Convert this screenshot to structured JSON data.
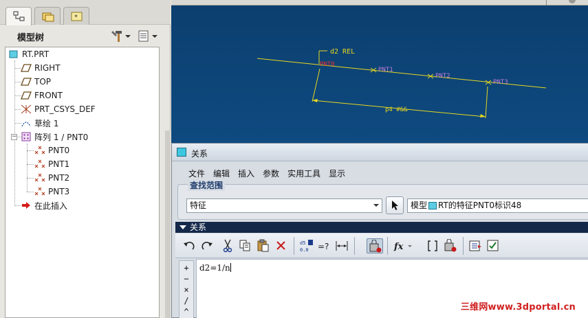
{
  "left_panel": {
    "tree_title": "模型树",
    "tabs": [
      "model-tree-tab",
      "folder-browser-tab",
      "favorites-tab"
    ],
    "tree_items": [
      {
        "label": "RT.PRT",
        "icon": "part-icon"
      },
      {
        "label": "RIGHT",
        "icon": "datum-plane-icon"
      },
      {
        "label": "TOP",
        "icon": "datum-plane-icon"
      },
      {
        "label": "FRONT",
        "icon": "datum-plane-icon"
      },
      {
        "label": "PRT_CSYS_DEF",
        "icon": "coordinate-system-icon"
      },
      {
        "label": "草绘 1",
        "icon": "sketch-icon"
      },
      {
        "label": "阵列 1 / PNT0",
        "icon": "pattern-icon"
      },
      {
        "label": "PNT0",
        "icon": "datum-point-icon"
      },
      {
        "label": "PNT1",
        "icon": "datum-point-icon"
      },
      {
        "label": "PNT2",
        "icon": "datum-point-icon"
      },
      {
        "label": "PNT3",
        "icon": "datum-point-icon"
      },
      {
        "label": "在此插入",
        "icon": "insert-here-arrow-icon"
      }
    ]
  },
  "viewport": {
    "dimension_label": "d2 REL",
    "pattern_label": "p4 #&&",
    "points": [
      "PNT0",
      "PNT1",
      "PNT2",
      "PNT3"
    ],
    "colors": {
      "line": "#e8d820",
      "point_label": "#c07ad8",
      "pnt0_label": "#e83030"
    }
  },
  "dialog": {
    "title": "关系",
    "menu": [
      "文件",
      "编辑",
      "插入",
      "参数",
      "实用工具",
      "显示"
    ],
    "find_scope": {
      "label": "查找范围",
      "combo_value": "特征",
      "ref_prefix": "模型",
      "ref_text": "RT的特征PNT0标识48"
    },
    "relations_header": "关系",
    "toolbar_icons": [
      "undo-icon",
      "redo-icon",
      "cut-icon",
      "copy-icon",
      "paste-icon",
      "delete-icon",
      "parameter-display-icon",
      "evaluate-icon",
      "dimension-icon",
      "unit-sensitivity-icon",
      "function-icon",
      "bracket-icon",
      "sort-icon",
      "verify-icon",
      "checkbox-icon"
    ],
    "operators": [
      "+",
      "−",
      "×",
      "/",
      "^"
    ],
    "relation_text": "d2=1/n"
  },
  "watermark": "三维网www.3dportal.cn"
}
